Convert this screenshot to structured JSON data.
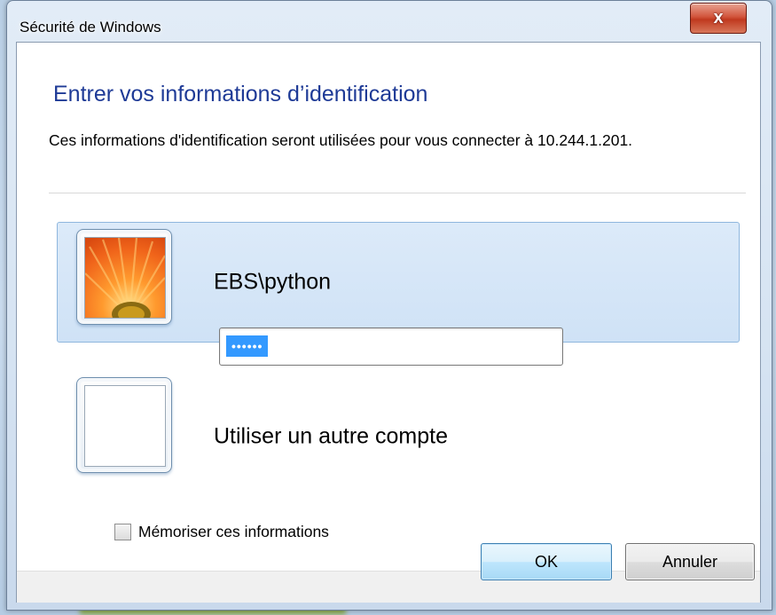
{
  "window": {
    "title": "Sécurité de Windows",
    "close_glyph": "x",
    "close_icon": "close-icon"
  },
  "dialog": {
    "heading": "Entrer vos informations d’identification",
    "description": "Ces informations d'identification seront utilisées pour vous connecter à 10.244.1.201."
  },
  "accounts": {
    "current": {
      "username": "EBS\\python",
      "password_mask": "••••••",
      "avatar_icon": "flower-avatar-icon"
    },
    "other": {
      "label": "Utiliser un autre compte",
      "avatar_icon": "blank-avatar-icon"
    }
  },
  "remember": {
    "label": "Mémoriser ces informations",
    "checked": false
  },
  "buttons": {
    "ok": "OK",
    "cancel": "Annuler"
  },
  "colors": {
    "heading": "#1e3a96",
    "selection": "#3399ff",
    "close_button": "#c0391f"
  }
}
